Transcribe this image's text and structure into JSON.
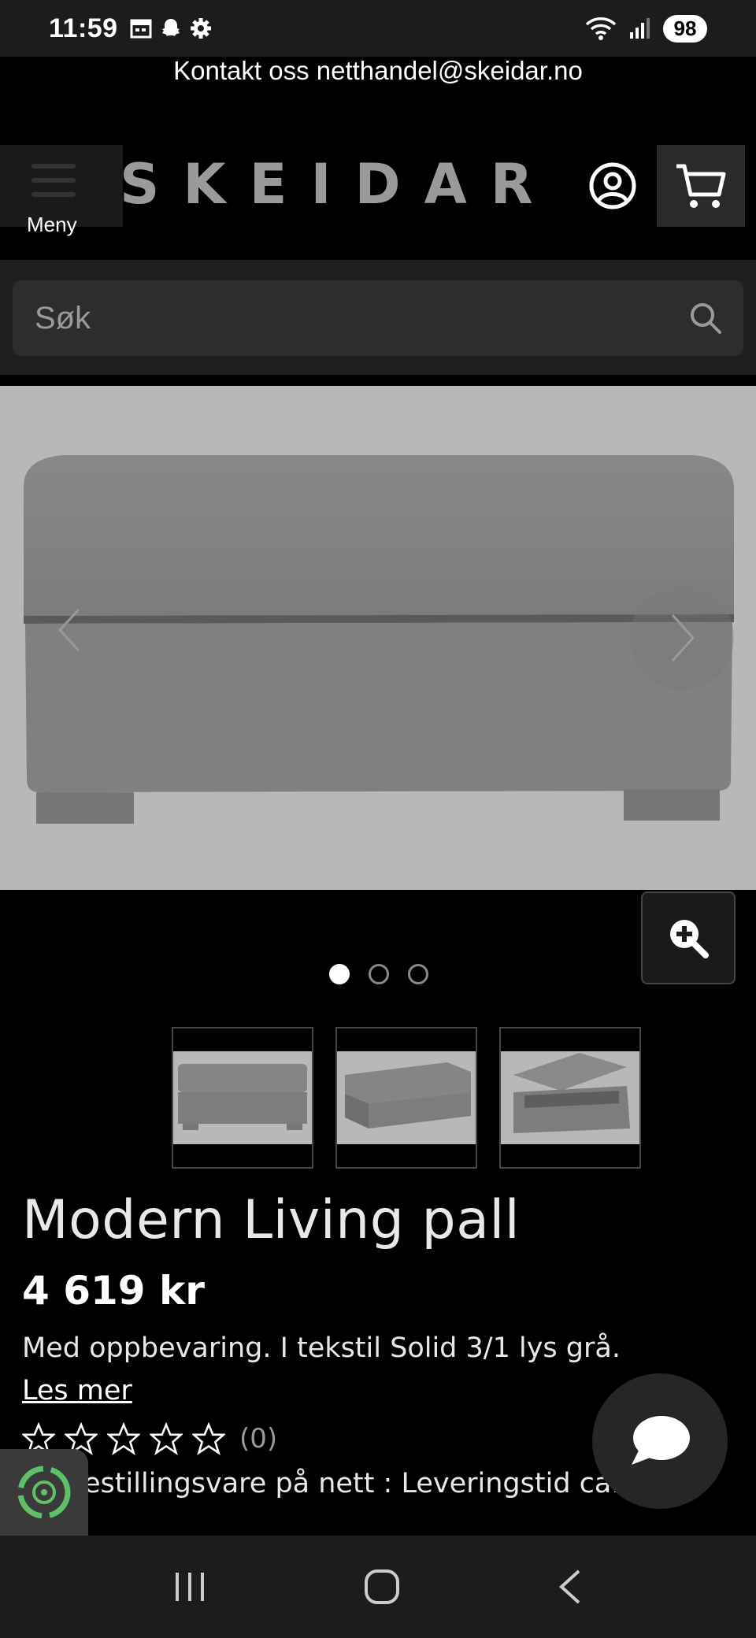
{
  "status_bar": {
    "time": "11:59",
    "battery": "98"
  },
  "header": {
    "contact_text": "Kontakt oss netthandel@skeidar.no",
    "logo": "SKEIDAR",
    "menu_label": "Meny"
  },
  "search": {
    "placeholder": "Søk"
  },
  "gallery": {
    "dot_count": 3,
    "active_index": 0,
    "thumbnail_count": 3
  },
  "product": {
    "title": "Modern Living pall",
    "price": "4 619 kr",
    "description": "Med oppbevaring. I tekstil Solid 3/1 lys grå.",
    "read_more": "Les mer",
    "rating_stars": 0,
    "rating_count": "(0)",
    "delivery": "estillingsvare på nett : Leveringstid ca. 5"
  },
  "colors": {
    "background": "#000000",
    "status_bar": "#1c1c1e",
    "product_image_bg": "#b8b8b8"
  }
}
